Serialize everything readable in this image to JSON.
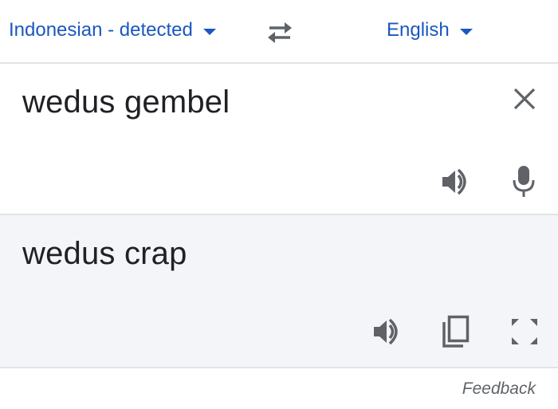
{
  "language_bar": {
    "source_language": "Indonesian - detected",
    "target_language": "English",
    "caret_icon": "arrow-drop-down-icon",
    "swap_icon": "swap-horiz-icon",
    "accent_color": "#1a58c0"
  },
  "source": {
    "text": "wedus gembel",
    "clear_icon": "close-icon",
    "speaker_icon": "volume-up-icon",
    "mic_icon": "mic-icon"
  },
  "result": {
    "text": "wedus crap",
    "speaker_icon": "volume-up-icon",
    "copy_icon": "content-copy-icon",
    "fullscreen_icon": "fullscreen-icon",
    "background_color": "#f4f5f9"
  },
  "footer": {
    "feedback_label": "Feedback"
  }
}
